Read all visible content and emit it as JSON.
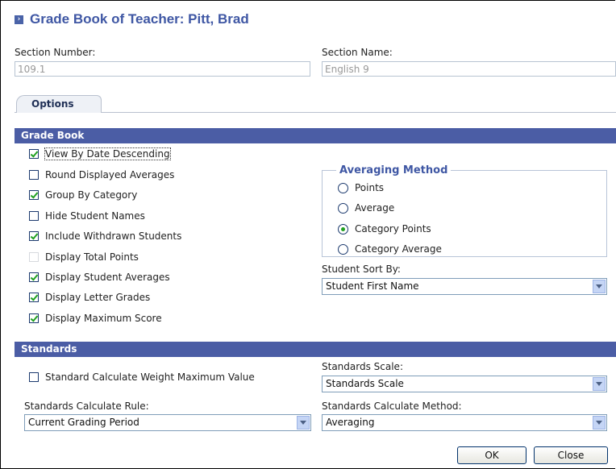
{
  "header": {
    "title": "Grade Book of Teacher: Pitt, Brad"
  },
  "section": {
    "number_label": "Section Number:",
    "number_value": "109.1",
    "name_label": "Section Name:",
    "name_value": "English 9"
  },
  "tabs": [
    {
      "label": "Options"
    }
  ],
  "gradebook": {
    "heading": "Grade Book",
    "options": [
      {
        "label": "View By Date Descending",
        "checked": true
      },
      {
        "label": "Round Displayed Averages",
        "checked": false
      },
      {
        "label": "Group By Category",
        "checked": true
      },
      {
        "label": "Hide Student Names",
        "checked": false
      },
      {
        "label": "Include Withdrawn Students",
        "checked": true
      },
      {
        "label": "Display Total Points",
        "checked": false,
        "disabled": true
      },
      {
        "label": "Display Student Averages",
        "checked": true
      },
      {
        "label": "Display Letter Grades",
        "checked": true
      },
      {
        "label": "Display Maximum Score",
        "checked": true
      }
    ],
    "averaging": {
      "legend": "Averaging Method",
      "options": [
        "Points",
        "Average",
        "Category Points",
        "Category Average"
      ],
      "selected": "Category Points"
    },
    "sort": {
      "label": "Student Sort By:",
      "value": "Student First Name"
    }
  },
  "standards": {
    "heading": "Standards",
    "weight_label": "Standard Calculate Weight Maximum Value",
    "weight_checked": false,
    "scale_label": "Standards Scale:",
    "scale_value": "Standards Scale",
    "rule_label": "Standards Calculate Rule:",
    "rule_value": "Current Grading Period",
    "method_label": "Standards Calculate Method:",
    "method_value": "Averaging"
  },
  "buttons": {
    "ok": "OK",
    "close": "Close"
  }
}
